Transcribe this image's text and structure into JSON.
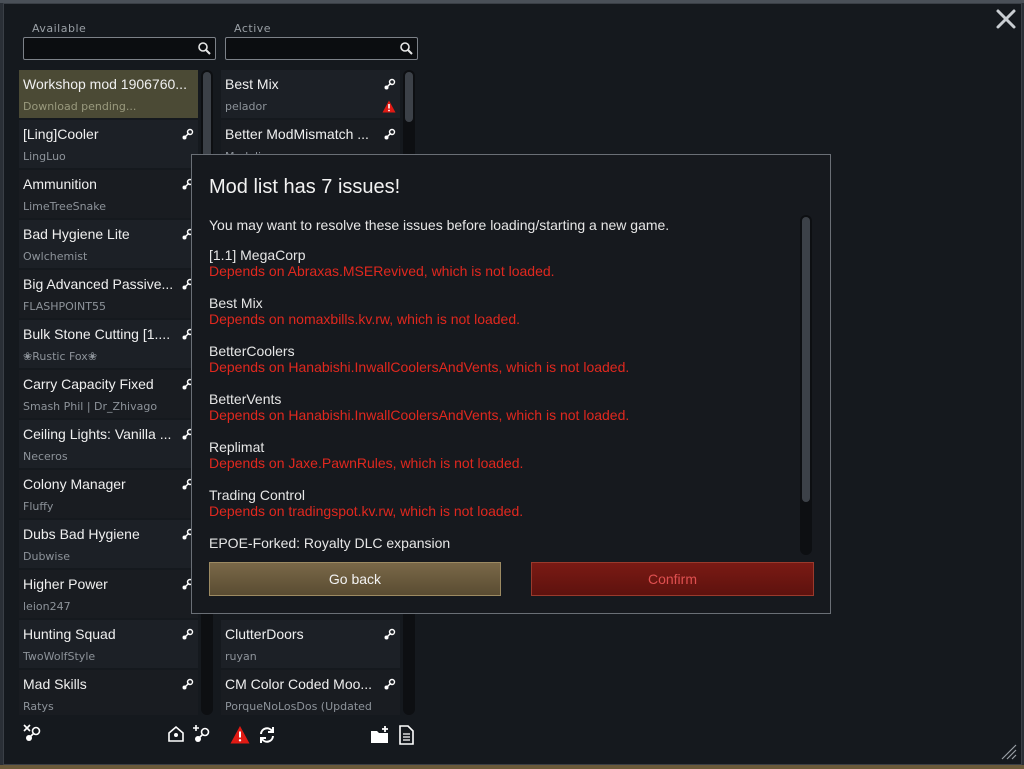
{
  "available": {
    "label": "Available",
    "search_placeholder": "",
    "mods": [
      {
        "name": "Workshop mod 1906760...",
        "author": "Download pending...",
        "state": "pending"
      },
      {
        "name": "[Ling]Cooler",
        "author": "LingLuo"
      },
      {
        "name": "Ammunition",
        "author": "LimeTreeSnake"
      },
      {
        "name": "Bad Hygiene Lite",
        "author": "Owlchemist"
      },
      {
        "name": "Big Advanced Passive...",
        "author": "FLASHPOINT55"
      },
      {
        "name": "Bulk Stone Cutting [1....",
        "author": "❀Rustic Fox❀"
      },
      {
        "name": "Carry Capacity Fixed",
        "author": "Smash Phil | Dr_Zhivago"
      },
      {
        "name": "Ceiling Lights: Vanilla ...",
        "author": "Neceros"
      },
      {
        "name": "Colony Manager",
        "author": "Fluffy"
      },
      {
        "name": "Dubs Bad Hygiene",
        "author": "Dubwise"
      },
      {
        "name": "Higher Power",
        "author": "leion247"
      },
      {
        "name": "Hunting Squad",
        "author": "TwoWolfStyle"
      },
      {
        "name": "Mad Skills",
        "author": "Ratys"
      }
    ]
  },
  "active": {
    "label": "Active",
    "search_placeholder": "",
    "mods_top": [
      {
        "name": "Best Mix",
        "author": "pelador",
        "warning": true
      },
      {
        "name": "Better ModMismatch ...",
        "author": "Madeline"
      }
    ],
    "mods_bottom": [
      {
        "name": "ClutterDoors",
        "author": "ruyan"
      },
      {
        "name": "CM Color Coded Moo...",
        "author": "PorqueNoLosDos (Updated"
      }
    ]
  },
  "dialog": {
    "title": "Mod list has 7 issues!",
    "subtitle": "You may want to resolve these issues before loading/starting a new game.",
    "issues": [
      {
        "mod": "[1.1] MegaCorp",
        "message": "Depends on Abraxas.MSERevived, which is not loaded."
      },
      {
        "mod": "Best Mix",
        "message": "Depends on nomaxbills.kv.rw, which is not loaded."
      },
      {
        "mod": "BetterCoolers",
        "message": "Depends on Hanabishi.InwallCoolersAndVents, which is not loaded."
      },
      {
        "mod": "BetterVents",
        "message": "Depends on Hanabishi.InwallCoolersAndVents, which is not loaded."
      },
      {
        "mod": "Replimat",
        "message": "Depends on Jaxe.PawnRules, which is not loaded."
      },
      {
        "mod": "Trading Control",
        "message": "Depends on tradingspot.kv.rw, which is not loaded."
      },
      {
        "mod": "EPOE-Forked: Royalty DLC expansion",
        "message": ""
      }
    ],
    "back_label": "Go back",
    "confirm_label": "Confirm"
  },
  "colors": {
    "window_bg": "#15191e",
    "error_red": "#e0281e",
    "back_button": "#6b5a3c",
    "confirm_button": "#6d1610"
  },
  "icons": {
    "close": "close-icon",
    "search": "search-icon",
    "steam": "steam-icon",
    "warning": "warning-icon",
    "refresh": "refresh-icon",
    "save": "save-list-icon",
    "document": "document-icon"
  }
}
